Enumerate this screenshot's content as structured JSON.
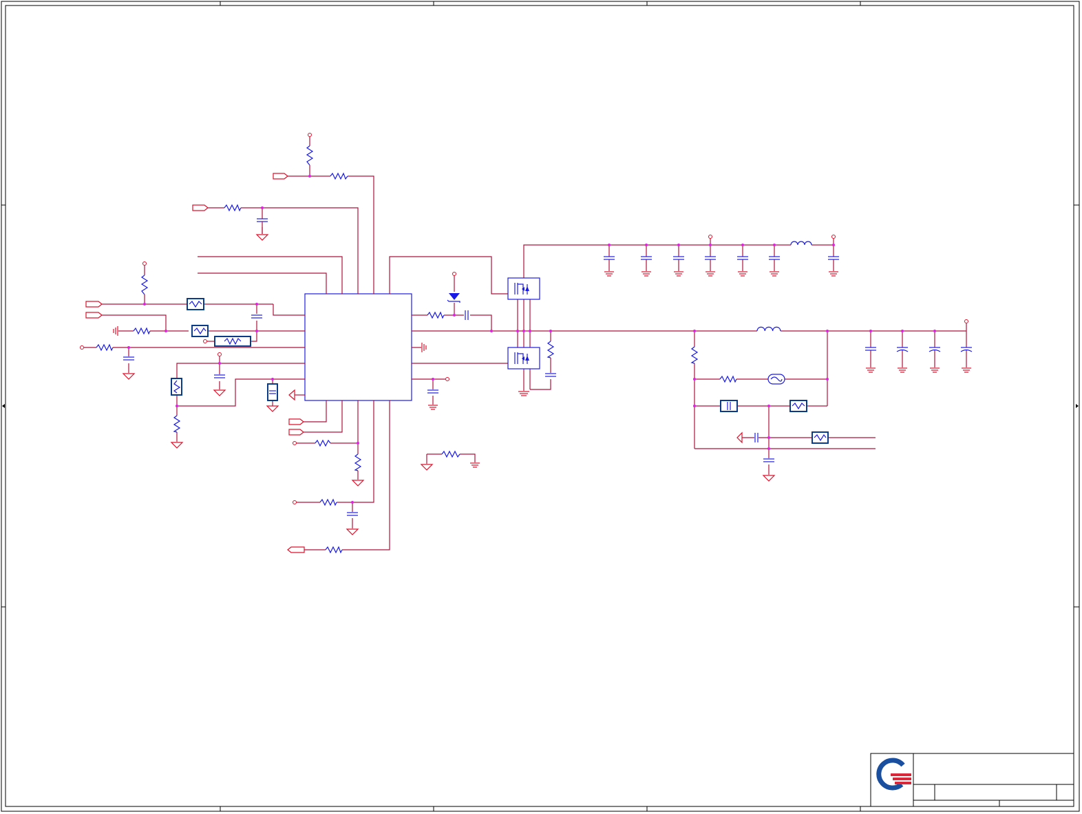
{
  "title_block": {
    "company_logo": "q-logo-icon",
    "title": "",
    "sheet": ""
  },
  "colors": {
    "wire": "#b0103a",
    "symbol": "#1a1ae6",
    "ground_power": "#e0102a",
    "junction": "#e020e0",
    "frame": "#000000",
    "logo_blue": "#1a4fa0",
    "logo_red": "#d8283a"
  }
}
